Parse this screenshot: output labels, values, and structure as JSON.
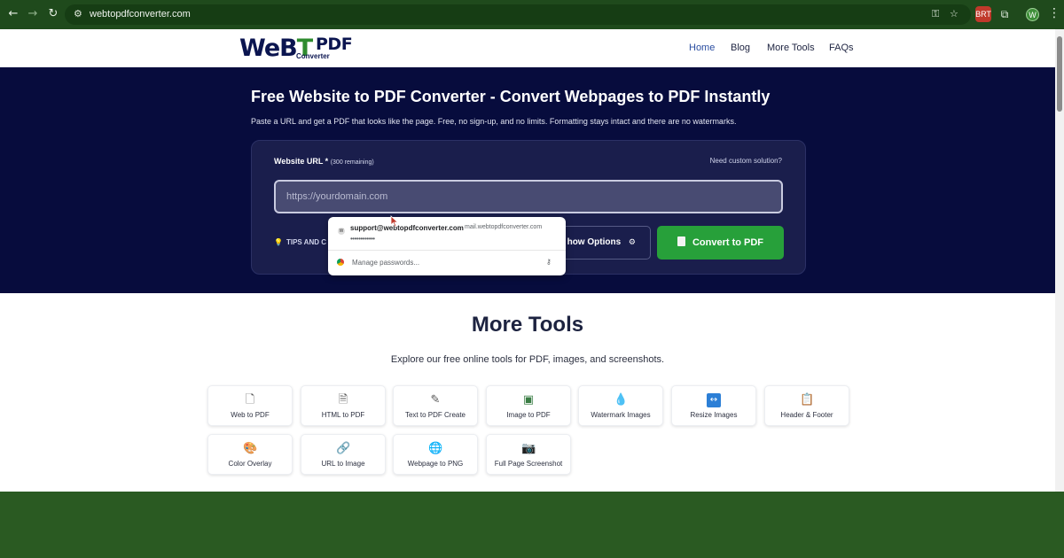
{
  "browser": {
    "url": "webtopdfconverter.com",
    "profile_initial": "W",
    "extension_badge": "BRT"
  },
  "header": {
    "logo_main": "WeB",
    "logo_t": "T",
    "logo_pdf": "PDF",
    "logo_sub": "Converter",
    "nav": [
      "Home",
      "Blog",
      "More Tools",
      "FAQs"
    ],
    "active_nav": "Home"
  },
  "hero": {
    "title": "Free Website to PDF Converter - Convert Webpages to PDF Instantly",
    "subtitle": "Paste a URL and get a PDF that looks like the page. Free, no sign-up, and no limits. Formatting stays intact and there are no watermarks.",
    "url_label": "Website URL *",
    "remaining": "(300 remaining)",
    "custom_link": "Need custom solution?",
    "url_placeholder": "https://yourdomain.com",
    "tips_label": "TIPS AND C",
    "show_options": "how Options",
    "convert_label": "Convert to PDF"
  },
  "autofill": {
    "account": "support@webtopdfconverter.com",
    "domain": "mail.webtopdfconverter.com",
    "password_mask": "••••••••••••",
    "manage": "Manage passwords..."
  },
  "tools": {
    "title": "More Tools",
    "subtitle": "Explore our free online tools for PDF, images, and screenshots.",
    "items": [
      {
        "name": "Web to PDF",
        "icon": "document-icon"
      },
      {
        "name": "HTML to PDF",
        "icon": "html-file-icon"
      },
      {
        "name": "Text to PDF Create",
        "icon": "pencil-document-icon"
      },
      {
        "name": "Image to PDF",
        "icon": "image-icon"
      },
      {
        "name": "Watermark Images",
        "icon": "droplet-icon"
      },
      {
        "name": "Resize Images",
        "icon": "resize-icon"
      },
      {
        "name": "Header & Footer",
        "icon": "clipboard-icon"
      },
      {
        "name": "Color Overlay",
        "icon": "palette-icon"
      },
      {
        "name": "URL to Image",
        "icon": "link-icon"
      },
      {
        "name": "Webpage to PNG",
        "icon": "globe-icon"
      },
      {
        "name": "Full Page Screenshot",
        "icon": "camera-icon"
      }
    ]
  },
  "colors": {
    "hero_bg": "#070c3d",
    "brand_navy": "#0b1550",
    "brand_green": "#2e8b2e",
    "convert_green": "#27a03a",
    "chrome_green": "#1f4a1c"
  }
}
